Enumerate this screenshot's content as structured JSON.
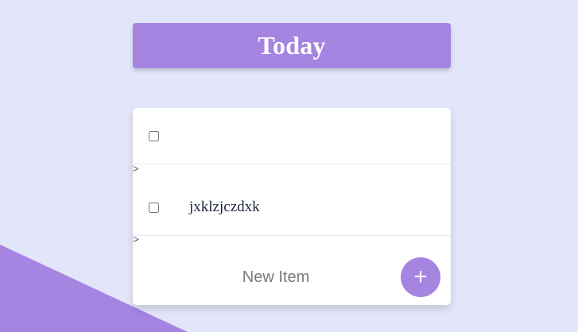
{
  "header": {
    "title": "Today"
  },
  "todo_list": {
    "items": [
      {
        "text": "",
        "checked": false,
        "marker": ">"
      },
      {
        "text": "jxklzjczdxk",
        "checked": false,
        "marker": ">"
      }
    ],
    "new_item": {
      "placeholder": "New Item",
      "value": ""
    },
    "add_button": {
      "label": "+",
      "icon": "plus-icon"
    }
  },
  "colors": {
    "background": "#E3E6FA",
    "accent": "#A584E2",
    "card": "#FFFFFF",
    "item_text": "#1E2740"
  }
}
